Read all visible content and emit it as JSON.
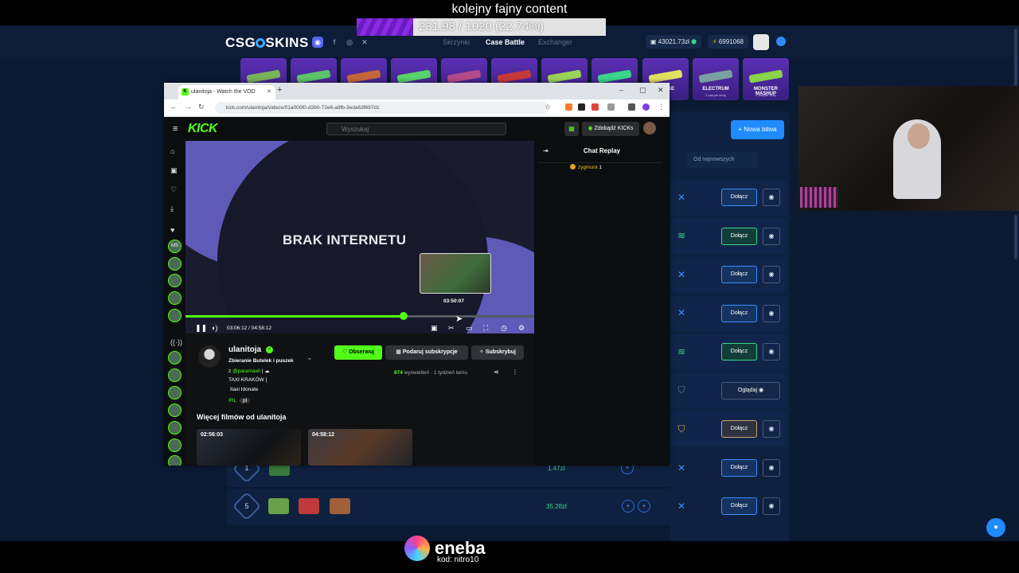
{
  "overlay": {
    "goal_title": "kolejny fajny content",
    "goal_text": "231.98 / 1020 (22.74%)",
    "goal_progress_percent": 22.74,
    "sponsor_name": "eneba",
    "sponsor_code": "kod: nitro10"
  },
  "site": {
    "logo_left": "CSG",
    "logo_right": "SKINS",
    "nav": [
      "Skrzynki",
      "Case Battle",
      "Exchanger"
    ],
    "balance": "43021.73zł",
    "coins": "6991068",
    "social_icons": [
      "discord-icon",
      "facebook-icon",
      "instagram-icon",
      "x-icon"
    ],
    "cases": [
      {
        "name": "",
        "sub": ""
      },
      {
        "name": "",
        "sub": ""
      },
      {
        "name": "",
        "sub": ""
      },
      {
        "name": "",
        "sub": ""
      },
      {
        "name": "",
        "sub": ""
      },
      {
        "name": "",
        "sub": ""
      },
      {
        "name": "",
        "sub": ""
      },
      {
        "name": "",
        "sub": ""
      },
      {
        "name": "ROUGE",
        "sub": ""
      },
      {
        "name": "ELECTRUM",
        "sub": "2 zakryte fanty"
      },
      {
        "name": "MONSTER MASHUP",
        "sub": "2 zakryte fanty"
      }
    ],
    "new_battle_label": "+ Nowa bitwa",
    "sort_label": "Od najnowszych",
    "join_label": "Dołącz",
    "watch_label": "Oglądaj",
    "bottom_rows": [
      {
        "round": "1",
        "price": "1.47zł"
      },
      {
        "round": "5",
        "price": "35.28zł"
      }
    ],
    "colors": {
      "accent": "#1f8bff",
      "success": "#3ad68a",
      "bg": "#0b1a33"
    }
  },
  "browser": {
    "tab_title": "ulanitoja - Watch the VOD",
    "tab_favicon": "K",
    "url": "kick.com/ulanitoja/videos/01a000f0-d2b0-72e6-a9fb-3eda63f697d1",
    "window_controls": [
      "–",
      "▢",
      "✕"
    ]
  },
  "kick": {
    "logo": "KICK",
    "search_placeholder": "Wyszukaj",
    "kicks_label": "Zdobądź KICKs",
    "video_text": "BRAK INTERNETU",
    "hover_time": "03:50:07",
    "time_display": "03:06:12 / 04:58:12",
    "progress_fraction": 0.625,
    "side_avatar_text": "MS",
    "streamer": {
      "name": "ulanitoja",
      "title": "Zbieranie Butelek i puszek",
      "line2_prefix": "z",
      "mention": "@paramaxil",
      "line3": "TAXI KRAKÓW |",
      "line4": "Itaxi Idonate",
      "tag_irl": "IRL",
      "tag_lang": "pl"
    },
    "follow_label": "Obserwuj",
    "gift_label": "Podaruj subskrypcje",
    "subscribe_label": "Subskrybuj",
    "views_count": "874",
    "views_suffix": "wyświetleń",
    "age": "1 tydzień temu",
    "more_title": "Więcej filmów od ulanitoja",
    "vods": [
      {
        "duration": "02:56:03"
      },
      {
        "duration": "04:58:12"
      }
    ],
    "chat": {
      "title": "Chat Replay",
      "messages": [
        {
          "user": "zygmunt",
          "text": "1"
        }
      ]
    }
  }
}
